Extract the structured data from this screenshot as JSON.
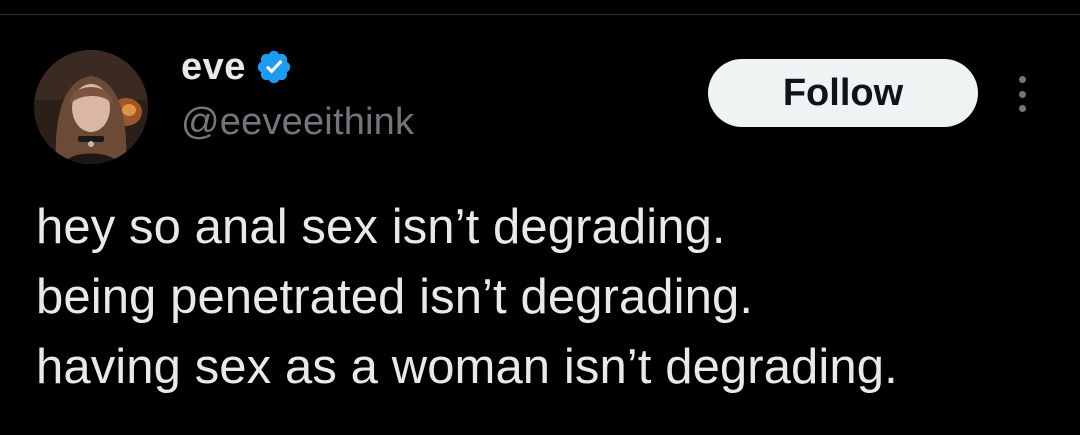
{
  "author": {
    "display_name": "eve",
    "handle": "@eeveeithink",
    "verified": true,
    "avatar_icon": "profile-photo"
  },
  "actions": {
    "follow_label": "Follow",
    "more_icon": "more-vertical-icon"
  },
  "tweet": {
    "lines": [
      "hey so anal sex isn’t degrading.",
      "being penetrated isn’t degrading.",
      "having sex as a woman isn’t degrading."
    ]
  },
  "colors": {
    "background": "#000000",
    "text_primary": "#e7e9ea",
    "text_secondary": "#71767b",
    "verified_blue": "#1d9bf0",
    "follow_button_bg": "#eff3f4",
    "follow_button_text": "#0f1419"
  }
}
